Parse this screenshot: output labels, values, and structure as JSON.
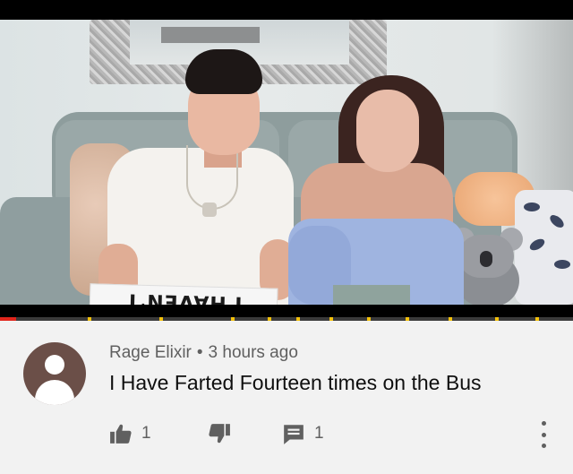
{
  "video": {
    "sign_text": "I HAVEN'T",
    "progress_fraction": 0.028,
    "progress_color": "#e1251b",
    "ad_marker_color": "#f4c20d"
  },
  "comment": {
    "author": "Rage Elixir",
    "separator": "•",
    "time": "3 hours ago",
    "text": "I Have Farted Fourteen times on the Bus",
    "avatar_color": "#6b4f48",
    "likes": "1",
    "replies": "1",
    "icons": {
      "like": "thumbs-up-icon",
      "dislike": "thumbs-down-icon",
      "reply": "comment-icon",
      "menu": "more-vertical-icon"
    }
  }
}
